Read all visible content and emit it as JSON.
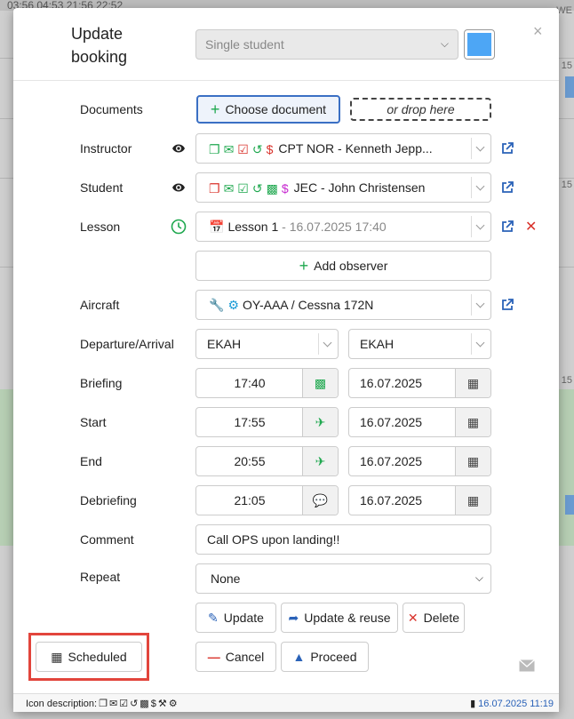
{
  "background": {
    "status_bar": "03:56   04:53   21:56   22:52",
    "right_labels": [
      "WE",
      "15",
      "15",
      "15"
    ]
  },
  "header": {
    "title": "Update booking",
    "mode_select": "Single student",
    "color": "#4da6f5"
  },
  "form": {
    "documents": {
      "label": "Documents",
      "choose_label": "Choose document",
      "drop_label": "or drop here"
    },
    "instructor": {
      "label": "Instructor",
      "value": "CPT NOR - Kenneth Jepp..."
    },
    "student": {
      "label": "Student",
      "value": "JEC - John Christensen"
    },
    "lesson": {
      "label": "Lesson",
      "value": "Lesson 1",
      "datetime": " - 16.07.2025 17:40"
    },
    "add_observer": "Add observer",
    "aircraft": {
      "label": "Aircraft",
      "value": "OY-AAA / Cessna 172N"
    },
    "departure_arrival": {
      "label": "Departure/Arrival",
      "departure": "EKAH",
      "arrival": "EKAH"
    },
    "briefing": {
      "label": "Briefing",
      "time": "17:40",
      "date": "16.07.2025"
    },
    "start": {
      "label": "Start",
      "time": "17:55",
      "date": "16.07.2025"
    },
    "end": {
      "label": "End",
      "time": "20:55",
      "date": "16.07.2025"
    },
    "debriefing": {
      "label": "Debriefing",
      "time": "21:05",
      "date": "16.07.2025"
    },
    "comment": {
      "label": "Comment",
      "value": "Call OPS upon landing!!"
    },
    "repeat": {
      "label": "Repeat",
      "value": "None"
    }
  },
  "actions": {
    "update": "Update",
    "update_reuse": "Update & reuse",
    "delete": "Delete",
    "cancel": "Cancel",
    "proceed": "Proceed",
    "scheduled": "Scheduled"
  },
  "footer": {
    "icon_description": "Icon description:",
    "timestamp": "16.07.2025 11:19"
  },
  "colors": {
    "accent": "#2a62b8",
    "green": "#1fa84f",
    "red": "#d9322b",
    "magenta": "#c72ad0",
    "highlight": "#e2453c"
  }
}
